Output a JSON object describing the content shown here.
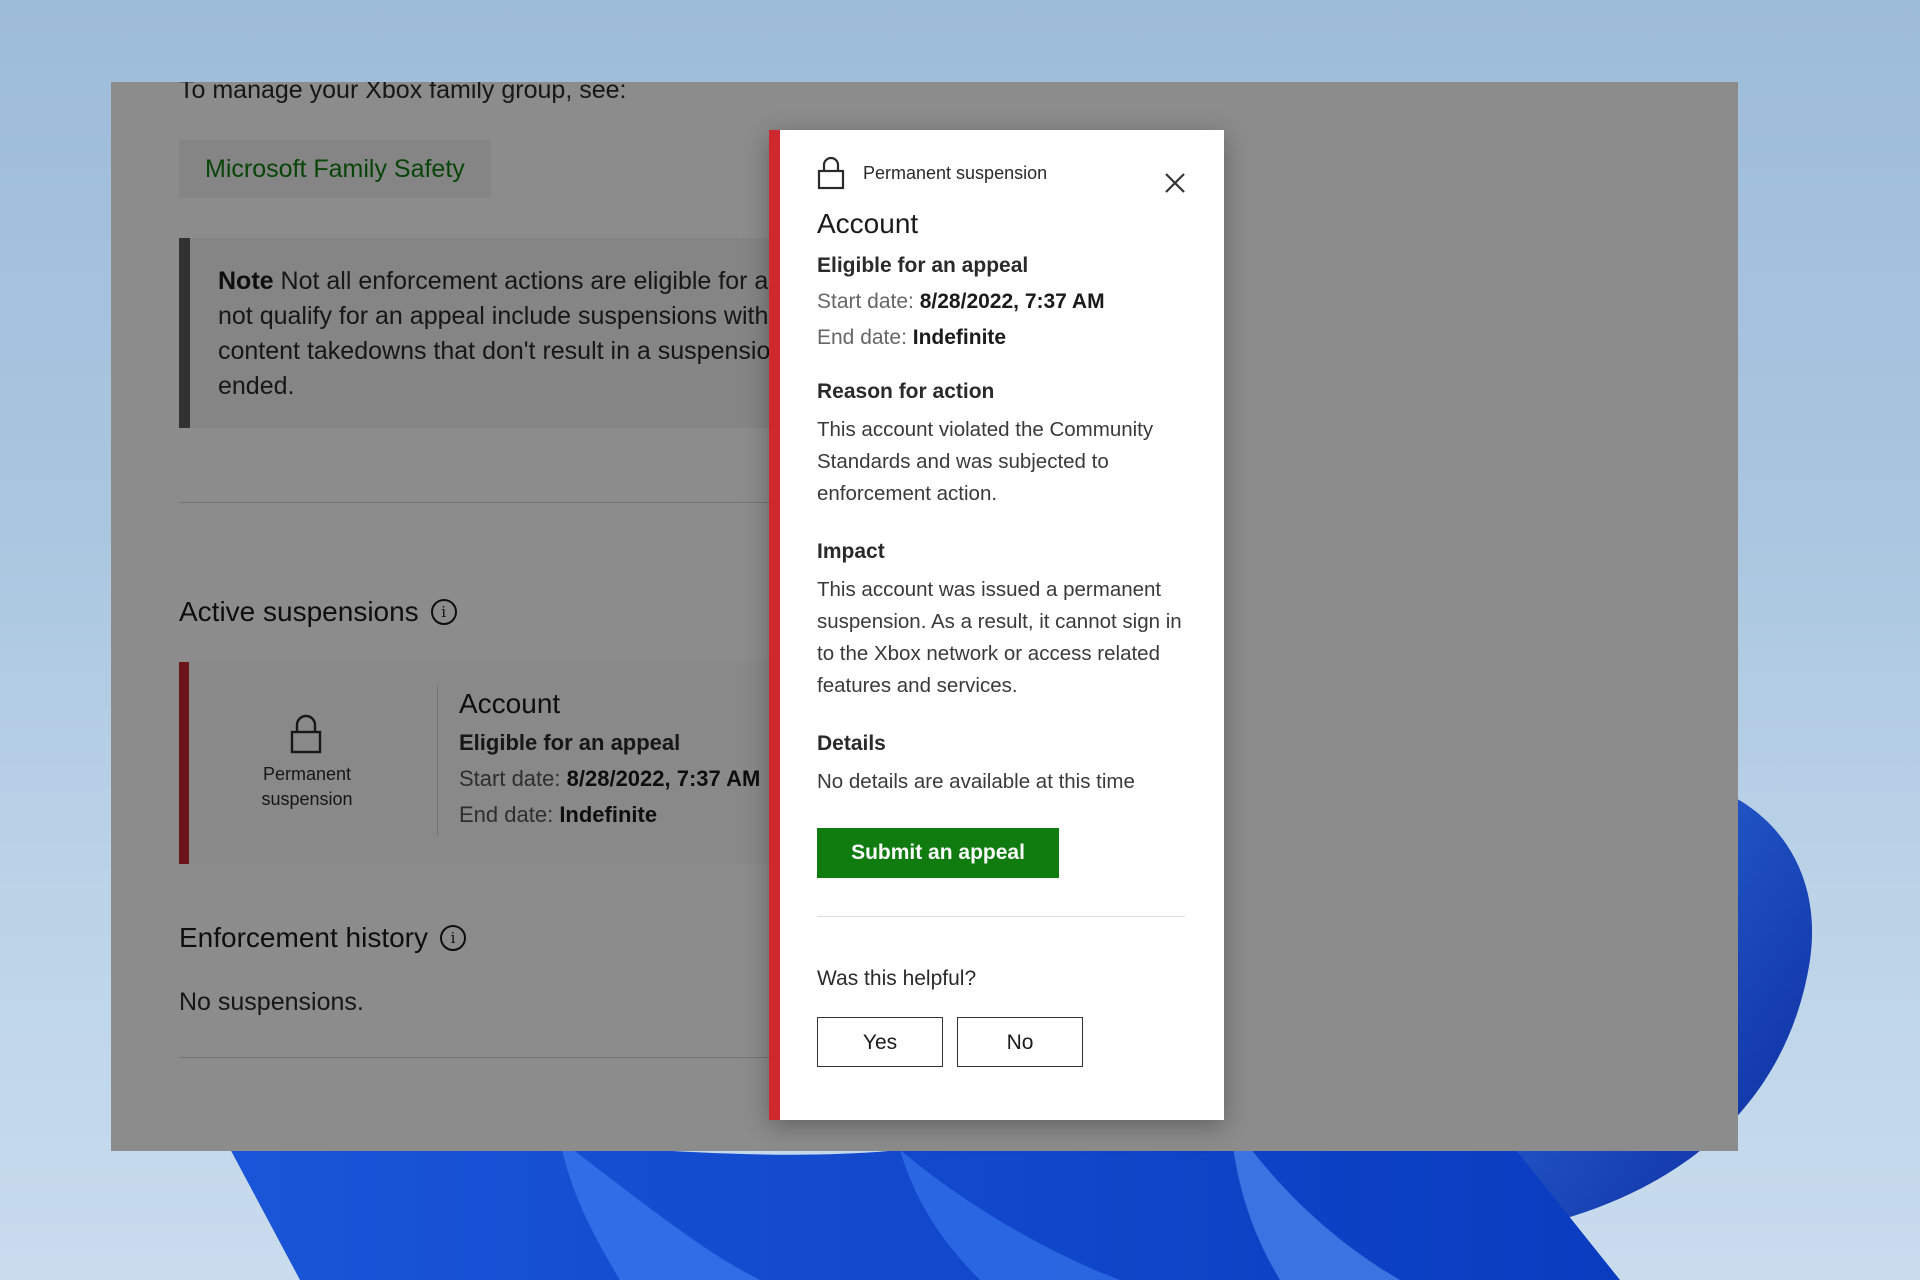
{
  "page": {
    "manage_text": "To manage your Xbox family group, see:",
    "family_link": "Microsoft Family Safety",
    "note": {
      "label": "Note",
      "line1": "Not all enforcement actions are eligible for a",
      "line2": "not qualify for an appeal include suspensions with",
      "line3": "content takedowns that don't result in a suspensio",
      "line4": "ended."
    },
    "active_suspensions": {
      "title": "Active suspensions",
      "info_icon": "info-icon",
      "card": {
        "icon": "lock-icon",
        "type_line1": "Permanent",
        "type_line2": "suspension",
        "title": "Account",
        "eligibility": "Eligible for an appeal",
        "start_label": "Start date:",
        "start_value": "8/28/2022, 7:37 AM",
        "end_label": "End date:",
        "end_value": "Indefinite"
      }
    },
    "enforcement_history": {
      "title": "Enforcement history",
      "info_icon": "info-icon",
      "empty_text": "No suspensions."
    }
  },
  "dialog": {
    "icon": "lock-icon",
    "header_label": "Permanent suspension",
    "close_icon": "close-icon",
    "title": "Account",
    "eligibility": "Eligible for an appeal",
    "start_label": "Start date:",
    "start_value": "8/28/2022, 7:37 AM",
    "end_label": "End date:",
    "end_value": "Indefinite",
    "reason_heading": "Reason for action",
    "reason_text": "This account violated the Community Standards and was subjected to enforcement action.",
    "impact_heading": "Impact",
    "impact_text": "This account was issued a permanent suspension. As a result, it cannot sign in to the Xbox network or access related features and services.",
    "details_heading": "Details",
    "details_text": "No details are available at this time",
    "submit_label": "Submit an appeal",
    "helpful_question": "Was this helpful?",
    "yes_label": "Yes",
    "no_label": "No"
  },
  "colors": {
    "accent_green": "#107c10",
    "suspension_red": "#d0282f",
    "overlay": "rgba(0,0,0,0.45)"
  }
}
